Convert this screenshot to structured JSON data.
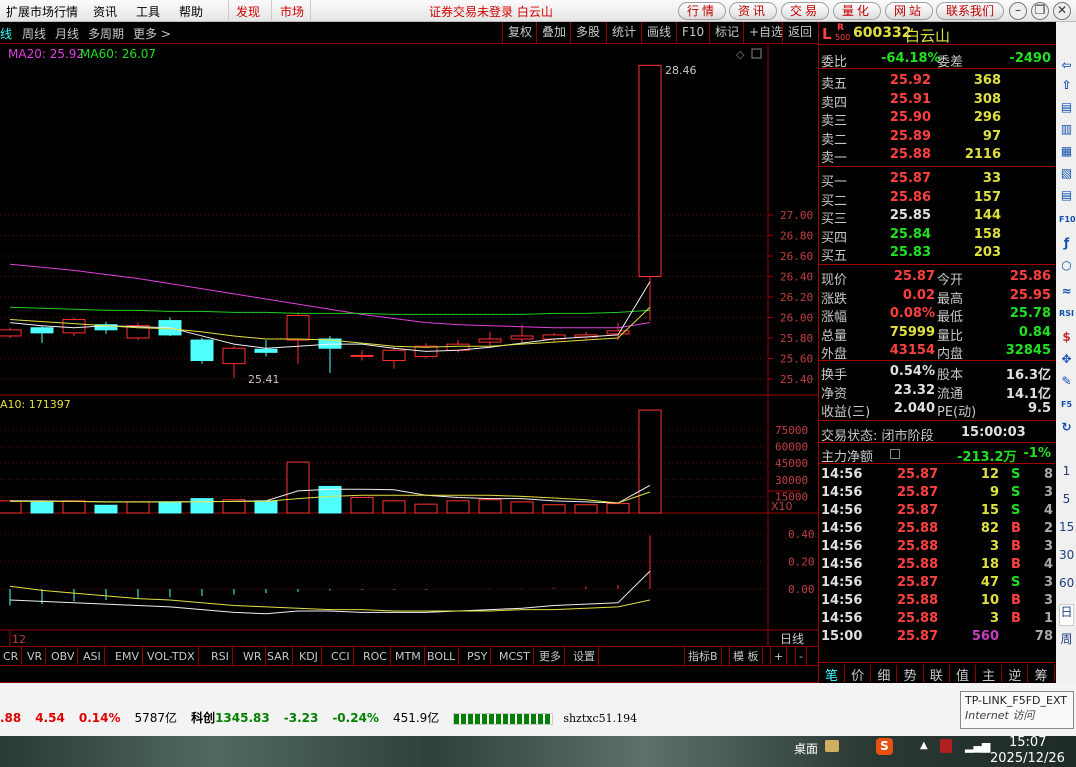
{
  "menubar": {
    "items": [
      "扩展市场行情",
      "资讯",
      "工具",
      "帮助"
    ],
    "red_items": [
      "发现",
      "市场"
    ],
    "title": "证券交易未登录  白云山",
    "pills": [
      "行情",
      "资讯",
      "交易",
      "量化",
      "网站",
      "联系我们"
    ],
    "window_controls": [
      "–",
      "❐",
      "✕"
    ]
  },
  "toolbar": {
    "left": [
      "线",
      "周线",
      "月线",
      "多周期",
      "更多 >"
    ],
    "right": [
      "复权",
      "叠加",
      "多股",
      "统计",
      "画线",
      "F10",
      "标记",
      "+自选",
      "返回"
    ]
  },
  "chart_labels": {
    "ma_legend_20": "MA20: 25.92",
    "ma_legend_60": "MA60: 26.07",
    "high_mark": "28.46",
    "low_mark": "25.41",
    "vol_legend": "A10: 171397",
    "vol_unit": "X10",
    "date_label": "12",
    "period": "日线"
  },
  "chart_data": {
    "type": "candlestick",
    "price_ticks": [
      "27.00",
      "26.80",
      "26.60",
      "26.40",
      "26.20",
      "26.00",
      "25.80",
      "25.60",
      "25.40"
    ],
    "price_range": [
      25.2,
      28.6
    ],
    "candles": [
      [
        25.82,
        25.9,
        25.8,
        25.88
      ],
      [
        25.9,
        25.92,
        25.75,
        25.85
      ],
      [
        25.85,
        26.0,
        25.82,
        25.98
      ],
      [
        25.93,
        25.96,
        25.84,
        25.88
      ],
      [
        25.8,
        25.95,
        25.78,
        25.92
      ],
      [
        25.97,
        26.0,
        25.82,
        25.83
      ],
      [
        25.78,
        25.8,
        25.55,
        25.58
      ],
      [
        25.55,
        25.72,
        25.41,
        25.7
      ],
      [
        25.69,
        25.78,
        25.62,
        25.66
      ],
      [
        25.78,
        26.05,
        25.55,
        26.02
      ],
      [
        25.79,
        25.82,
        25.46,
        25.7
      ],
      [
        25.62,
        25.68,
        25.58,
        25.63
      ],
      [
        25.58,
        25.72,
        25.5,
        25.68
      ],
      [
        25.62,
        25.75,
        25.6,
        25.72
      ],
      [
        25.68,
        25.78,
        25.66,
        25.74
      ],
      [
        25.76,
        25.86,
        25.7,
        25.79
      ],
      [
        25.79,
        25.93,
        25.75,
        25.82
      ],
      [
        25.79,
        25.85,
        25.76,
        25.83
      ],
      [
        25.81,
        25.86,
        25.78,
        25.83
      ],
      [
        25.84,
        25.95,
        25.78,
        25.87
      ],
      [
        26.4,
        28.46,
        25.97,
        28.46
      ]
    ],
    "ma20": [
      26.52,
      26.49,
      26.46,
      26.42,
      26.38,
      26.33,
      26.28,
      26.23,
      26.18,
      26.13,
      26.08,
      26.03,
      25.99,
      25.95,
      25.93,
      25.92,
      25.91,
      25.9,
      25.9,
      25.9,
      25.95
    ],
    "ma60": [
      26.1,
      26.09,
      26.08,
      26.07,
      26.07,
      26.06,
      26.06,
      26.05,
      26.05,
      26.04,
      26.04,
      26.04,
      26.03,
      26.03,
      26.03,
      26.03,
      26.03,
      26.04,
      26.04,
      26.05,
      26.07
    ],
    "ma5": [
      25.95,
      25.92,
      25.9,
      25.92,
      25.91,
      25.9,
      25.82,
      25.74,
      25.7,
      25.72,
      25.74,
      25.74,
      25.7,
      25.67,
      25.68,
      25.71,
      25.75,
      25.79,
      25.81,
      25.83,
      26.35
    ],
    "ma10": [
      25.98,
      25.96,
      25.94,
      25.92,
      25.9,
      25.89,
      25.86,
      25.82,
      25.79,
      25.79,
      25.78,
      25.75,
      25.72,
      25.71,
      25.72,
      25.72,
      25.74,
      25.76,
      25.78,
      25.8,
      26.1
    ],
    "vol_ticks": [
      "75000",
      "60000",
      "45000",
      "30000",
      "15000"
    ],
    "volumes": [
      11000,
      10000,
      11000,
      7000,
      10000,
      10000,
      13000,
      12000,
      11000,
      46000,
      24000,
      14000,
      11000,
      8000,
      11000,
      12000,
      10000,
      7500,
      7500,
      8500,
      93000
    ],
    "vol_ma5": [
      11000,
      11000,
      10500,
      10000,
      10000,
      10000,
      10300,
      10500,
      11000,
      20000,
      21500,
      21500,
      21000,
      16000,
      14000,
      13000,
      13000,
      11000,
      10000,
      9000,
      25000
    ],
    "vol_ma10": [
      10500,
      10500,
      10500,
      10000,
      10000,
      10000,
      10200,
      10500,
      10500,
      13000,
      15000,
      16000,
      16000,
      16000,
      16000,
      16000,
      15000,
      13500,
      12000,
      9000,
      19000
    ],
    "macd_ticks": [
      "0.40",
      "0.20",
      "0.00"
    ],
    "macd": [
      -0.12,
      -0.11,
      -0.09,
      -0.08,
      -0.07,
      -0.06,
      -0.05,
      -0.04,
      -0.03,
      -0.02,
      -0.01,
      -0.005,
      -0.005,
      -0.005,
      0.0,
      0.003,
      0.005,
      0.01,
      0.02,
      0.03,
      0.39
    ],
    "dif": [
      -0.08,
      -0.09,
      -0.1,
      -0.11,
      -0.12,
      -0.13,
      -0.15,
      -0.17,
      -0.18,
      -0.16,
      -0.16,
      -0.17,
      -0.17,
      -0.17,
      -0.16,
      -0.15,
      -0.14,
      -0.12,
      -0.11,
      -0.1,
      0.13
    ],
    "dea": [
      0.02,
      -0.01,
      -0.03,
      -0.05,
      -0.07,
      -0.08,
      -0.1,
      -0.12,
      -0.13,
      -0.14,
      -0.15,
      -0.15,
      -0.16,
      -0.16,
      -0.16,
      -0.16,
      -0.15,
      -0.15,
      -0.14,
      -0.13,
      -0.08
    ]
  },
  "indicators": {
    "tabs": [
      "CR",
      "VR",
      "OBV",
      "ASI",
      "EMV",
      "VOL-TDX",
      "RSI",
      "WR",
      "SAR",
      "KDJ",
      "CCI",
      "ROC",
      "MTM",
      "BOLL",
      "PSY",
      "MCST",
      "更多",
      "设置"
    ],
    "right": [
      "指标B",
      "模 板",
      "+",
      "-"
    ]
  },
  "quote": {
    "header": {
      "l": "L",
      "r": "R",
      "r_sub": "500",
      "code": "600332",
      "name": "白云山"
    },
    "weibi": {
      "label": "委比",
      "value": "-64.18%",
      "label2": "委差",
      "value2": "-2490"
    },
    "asks": [
      {
        "label": "卖五",
        "price": "25.92",
        "vol": "368"
      },
      {
        "label": "卖四",
        "price": "25.91",
        "vol": "308"
      },
      {
        "label": "卖三",
        "price": "25.90",
        "vol": "296"
      },
      {
        "label": "卖二",
        "price": "25.89",
        "vol": "97"
      },
      {
        "label": "卖一",
        "price": "25.88",
        "vol": "2116"
      }
    ],
    "bids": [
      {
        "label": "买一",
        "price": "25.87",
        "vol": "33"
      },
      {
        "label": "买二",
        "price": "25.86",
        "vol": "157"
      },
      {
        "label": "买三",
        "price": "25.85",
        "vol": "144"
      },
      {
        "label": "买四",
        "price": "25.84",
        "vol": "158"
      },
      {
        "label": "买五",
        "price": "25.83",
        "vol": "203"
      }
    ],
    "stats": [
      {
        "l1": "现价",
        "v1": "25.87",
        "c1": "r",
        "l2": "今开",
        "v2": "25.86",
        "c2": "r"
      },
      {
        "l1": "涨跌",
        "v1": "0.02",
        "c1": "r",
        "l2": "最高",
        "v2": "25.95",
        "c2": "r"
      },
      {
        "l1": "涨幅",
        "v1": "0.08%",
        "c1": "r",
        "l2": "最低",
        "v2": "25.78",
        "c2": "g"
      },
      {
        "l1": "总量",
        "v1": "75999",
        "c1": "y",
        "l2": "量比",
        "v2": "0.84",
        "c2": "g"
      },
      {
        "l1": "外盘",
        "v1": "43154",
        "c1": "r",
        "l2": "内盘",
        "v2": "32845",
        "c2": "g"
      }
    ],
    "fund": [
      {
        "l1": "换手",
        "v1": "0.54%",
        "l2": "股本",
        "v2": "16.3亿"
      },
      {
        "l1": "净资",
        "v1": "23.32",
        "l2": "流通",
        "v2": "14.1亿"
      },
      {
        "l1": "收益(三)",
        "v1": "2.040",
        "l2": "PE(动)",
        "v2": "9.5"
      }
    ],
    "trade_state": {
      "label": "交易状态: 闭市阶段",
      "time": "15:00:03"
    },
    "main_net": {
      "label": "主力净额",
      "value": "-213.2万",
      "pct": "-1%"
    },
    "ticks": [
      {
        "t": "14:56",
        "p": "25.87",
        "v": "12",
        "bs": "S",
        "n": "8"
      },
      {
        "t": "14:56",
        "p": "25.87",
        "v": "9",
        "bs": "S",
        "n": "3"
      },
      {
        "t": "14:56",
        "p": "25.87",
        "v": "15",
        "bs": "S",
        "n": "4"
      },
      {
        "t": "14:56",
        "p": "25.88",
        "v": "82",
        "bs": "B",
        "n": "2"
      },
      {
        "t": "14:56",
        "p": "25.88",
        "v": "3",
        "bs": "B",
        "n": "3"
      },
      {
        "t": "14:56",
        "p": "25.88",
        "v": "18",
        "bs": "B",
        "n": "4"
      },
      {
        "t": "14:56",
        "p": "25.87",
        "v": "47",
        "bs": "S",
        "n": "3"
      },
      {
        "t": "14:56",
        "p": "25.88",
        "v": "10",
        "bs": "B",
        "n": "3"
      },
      {
        "t": "14:56",
        "p": "25.88",
        "v": "3",
        "bs": "B",
        "n": "1"
      },
      {
        "t": "15:00",
        "p": "25.87",
        "v": "560",
        "bs": "",
        "n": "78"
      }
    ],
    "bottom_tabs": [
      "笔",
      "价",
      "细",
      "势",
      "联",
      "值",
      "主",
      "逆",
      "筹"
    ]
  },
  "right_strip": {
    "periods": [
      "1",
      "5",
      "15",
      "30",
      "60",
      "日",
      "周"
    ],
    "icon_labels": [
      "F10",
      "RSI",
      "F5"
    ]
  },
  "status": {
    "ticker": [
      ".88",
      "4.54",
      "0.14%",
      "5787亿",
      "科创",
      "1345.83",
      "-3.23",
      "-0.24%",
      "451.9亿"
    ],
    "server": "shztxc51.194"
  },
  "tooltip": {
    "line1": "TP-LINK_F5FD_EXT",
    "line2": "Internet 访问"
  },
  "taskbar": {
    "desktop": "桌面",
    "time": "15:07",
    "date": "2025/12/26"
  }
}
